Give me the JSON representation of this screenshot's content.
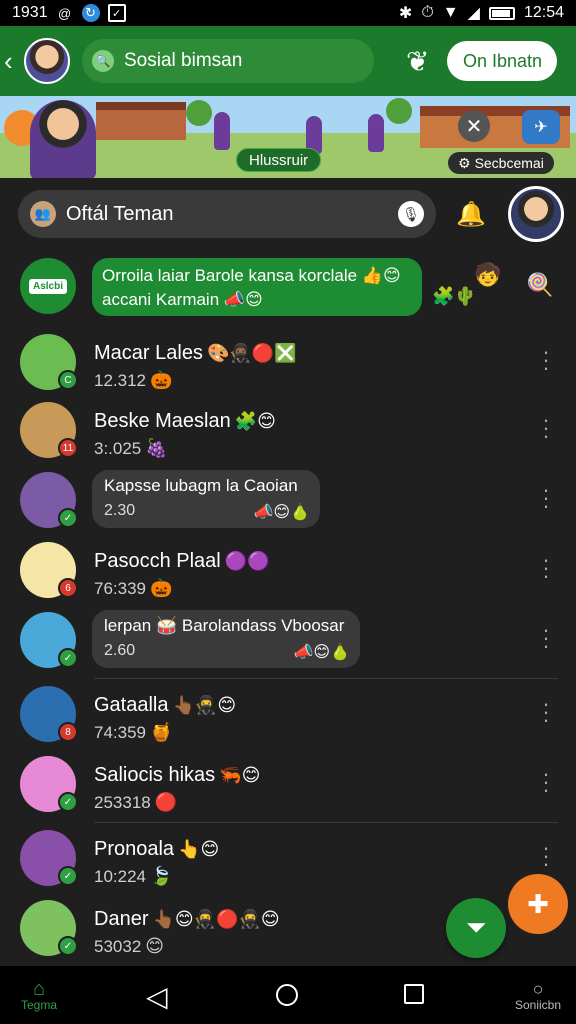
{
  "status_bar": {
    "time_left": "1931",
    "time_right": "12:54"
  },
  "app_bar": {
    "search_text": "Sosial bimsan",
    "online_button": "On Ibnatn"
  },
  "banner": {
    "label": "Hlussruir",
    "tag": "Secbcemai"
  },
  "search": {
    "placeholder": "Oftál Teman"
  },
  "pinned": {
    "line1": "Orroila laiar Barole kansa korclale",
    "line2": "accani Karmain",
    "group_logo_text": "Aslcbi"
  },
  "chats": [
    {
      "name": "Macar Lales",
      "sub": "12.312",
      "emoji": "🎨🥷🏾🔴❎",
      "sub_emoji": "🎃",
      "avatar_color": "#6bbd52",
      "badge_color": "#2ea043",
      "badge": "C"
    },
    {
      "name": "Beske Maeslan",
      "sub": "3:.025",
      "emoji": "🧩😊",
      "sub_emoji": "🍇",
      "avatar_color": "#c79a5a",
      "badge_color": "#d63a2e",
      "badge": "11"
    },
    {
      "name": "Kapsse lubagm la Caoian",
      "sub": "2.30",
      "emoji": "📣😊🍐",
      "sub_emoji": "⊛",
      "avatar_color": "#7b5aa6",
      "badge_color": "#2ea043",
      "badge": "✓"
    },
    {
      "name": "Pasocch Plaal",
      "sub": "76:339",
      "emoji": "🟣🟣",
      "sub_emoji": "🎃",
      "avatar_color": "#f5e6a8",
      "badge_color": "#d63a2e",
      "badge": "6"
    },
    {
      "name": "lerpan 🥁 Barolandass Vboosar",
      "sub": "2.60",
      "emoji": "📣😊🍐",
      "sub_emoji": "⊛",
      "avatar_color": "#4aa9d8",
      "badge_color": "#2ea043",
      "badge": "✓"
    },
    {
      "name": "Gataalla",
      "sub": "74:359",
      "emoji": "👆🏾🥷😊",
      "sub_emoji": "🍯",
      "avatar_color": "#2c6fb0",
      "badge_color": "#d63a2e",
      "badge": "8"
    },
    {
      "name": "Saliocis hikas",
      "sub": "253318",
      "emoji": "🦐😊",
      "sub_emoji": "🔴",
      "avatar_color": "#e78ad6",
      "badge_color": "#2ea043",
      "badge": "✓"
    },
    {
      "name": "Pronoala",
      "sub": "10:224",
      "emoji": "👆😊",
      "sub_emoji": "🍃",
      "avatar_color": "#8a4fa8",
      "badge_color": "#2ea043",
      "badge": "✓"
    },
    {
      "name": "Daner",
      "sub": "53032",
      "emoji": "👆🏾😊🥷🔴🥷😊",
      "sub_emoji": "😊",
      "avatar_color": "#7fc15e",
      "badge_color": "#2ea043",
      "badge": "✓"
    }
  ],
  "nav": {
    "home": "Tegma",
    "settings": "Soniicbn"
  }
}
